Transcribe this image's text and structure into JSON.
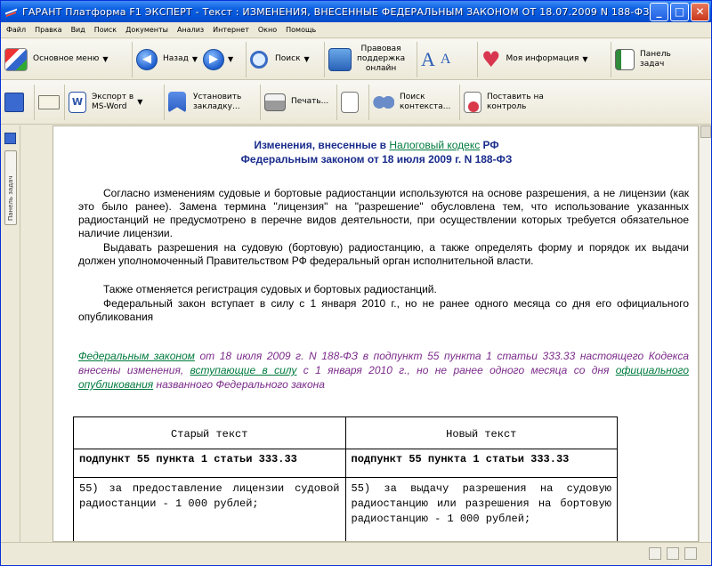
{
  "window": {
    "title": "ГАРАНТ Платформа F1 ЭКСПЕРТ - Текст : ИЗМЕНЕНИЯ, ВНЕСЕННЫЕ ФЕДЕРАЛЬНЫМ ЗАКОНОМ ОТ 18.07.2009 N 188-ФЗ",
    "minimize": "_",
    "maximize": "□",
    "close": "✕"
  },
  "menu": [
    "Файл",
    "Правка",
    "Вид",
    "Поиск",
    "Документы",
    "Анализ",
    "Интернет",
    "Окно",
    "Помощь"
  ],
  "toolbar1": {
    "main_menu": "Основное меню",
    "back": "Назад",
    "search": "Поиск",
    "legal_support_1": "Правовая",
    "legal_support_2": "поддержка",
    "legal_support_3": "онлайн",
    "my_info": "Моя информация",
    "task_panel_1": "Панель",
    "task_panel_2": "задач"
  },
  "toolbar2": {
    "export_1": "Экспорт в",
    "export_2": "MS-Word",
    "bookmark_1": "Установить",
    "bookmark_2": "закладку...",
    "print": "Печать...",
    "context_1": "Поиск",
    "context_2": "контекста...",
    "control_1": "Поставить на",
    "control_2": "контроль"
  },
  "side": {
    "tab_label": "Панель задач"
  },
  "doc": {
    "title_prefix": "Изменения, внесенные в ",
    "title_link": "Налоговый кодекс",
    "title_suffix": " РФ",
    "title_line2": "Федеральным законом от 18 июля 2009 г. N 188-ФЗ",
    "p1": "Согласно изменениям судовые и бортовые радиостанции используются на основе разрешения, а не лицензии (как это было ранее). Замена термина \"лицензия\" на \"разрешение\" обусловлена тем, что использование указанных радиостанций не предусмотрено в перечне видов деятельности, при осуществлении которых требуется обязательное наличие лицензии.",
    "p2": "Выдавать разрешения на судовую (бортовую) радиостанцию, а также определять форму и порядок их выдачи должен уполномоченный Правительством РФ федеральный орган исполнительной власти.",
    "p3": "Также отменяется регистрация судовых и бортовых радиостанций.",
    "p4": "Федеральный закон вступает в силу с 1 января 2010 г., но не ранее одного месяца со дня его официального опубликования",
    "note_link1": "Федеральным законом",
    "note_t1": " от 18 июля 2009 г. N 188-ФЗ в подпункт 55 пункта 1 статьи 333.33 настоящего Кодекса внесены изменения, ",
    "note_link2": "вступающие в силу",
    "note_t2": " с 1 января 2010 г., но не ранее одного месяца со дня ",
    "note_link3": "официального опубликования",
    "note_t3": " названного Федерального закона",
    "table": {
      "old_header": "Старый текст",
      "new_header": "Новый текст",
      "old_sub": "подпункт 55 пункта 1 статьи 333.33",
      "new_sub": "подпункт 55 пункта 1 статьи 333.33",
      "old_body": "55) за предоставление лицензии судовой радиостанции - 1 000 рублей;",
      "new_body": "55) за выдачу разрешения на судовую радиостанцию или разрешения на бортовую радиостанцию - 1 000 рублей;"
    }
  },
  "colors": {
    "title_blue": "#1a2c8c",
    "link_green": "#007a3d",
    "note_purple": "#7b2b8a",
    "titlebar": "#0553d6"
  }
}
